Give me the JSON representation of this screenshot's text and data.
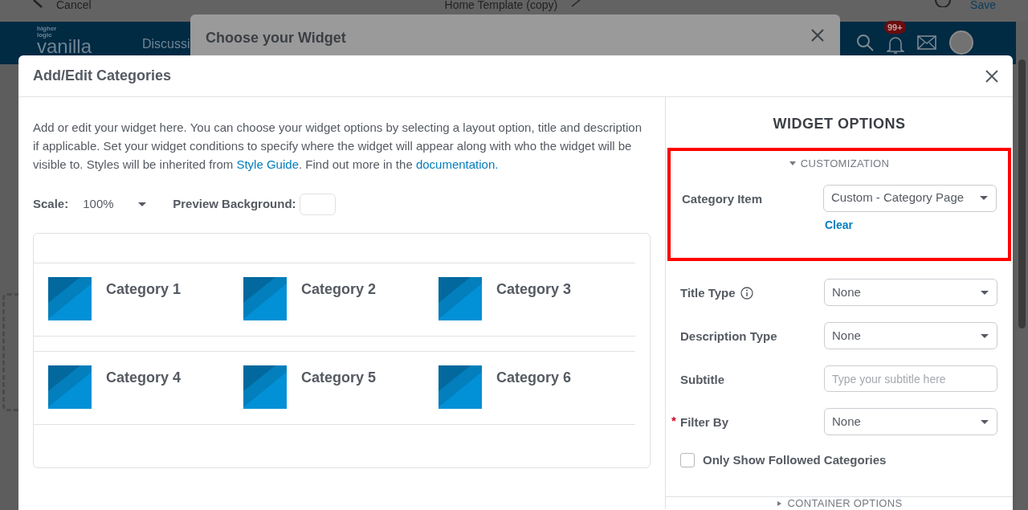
{
  "top_bar": {
    "back_label": "Cancel",
    "title": "Home Template (copy)",
    "save_label": "Save"
  },
  "site_header": {
    "logo_small": "higher logic",
    "logo": "vanilla",
    "nav_item": "Discussi",
    "badge": "99+"
  },
  "back_modal": {
    "title": "Choose your Widget"
  },
  "modal": {
    "title": "Add/Edit Categories",
    "description": [
      {
        "kind": "text",
        "text": "Add or edit your widget here. You can choose your widget options by selecting a layout option, title and description if applicable. Set your widget conditions to specify where the widget will appear along with who the widget will be visible to. Styles will be inherited from "
      },
      {
        "kind": "link",
        "text": "Style Guide"
      },
      {
        "kind": "text",
        "text": ". Find out more in the "
      },
      {
        "kind": "link",
        "text": "documentation."
      }
    ],
    "scale": {
      "label": "Scale:",
      "value": "100%"
    },
    "preview_background": {
      "label": "Preview Background:"
    },
    "category_rows": [
      [
        "Category 1",
        "Category 2",
        "Category 3"
      ],
      [
        "Category 4",
        "Category 5",
        "Category 6"
      ]
    ],
    "options": {
      "title": "WIDGET OPTIONS",
      "customization": {
        "title": "CUSTOMIZATION",
        "expanded": true,
        "highlighted": true,
        "label": "Category Item",
        "value": "Custom - Category Page",
        "clear": "Clear"
      },
      "fields": [
        {
          "kind": "select",
          "label": "Title Type",
          "info": true,
          "value": "None"
        },
        {
          "kind": "select",
          "label": "Description Type",
          "value": "None"
        },
        {
          "kind": "input",
          "label": "Subtitle",
          "placeholder": "Type your subtitle here"
        },
        {
          "kind": "select",
          "label": "Filter By",
          "required_mark": "*",
          "value": "None"
        },
        {
          "kind": "checkbox",
          "label": "Only Show Followed Categories",
          "checked": false
        }
      ],
      "container": {
        "title": "CONTAINER OPTIONS",
        "expanded": false
      }
    }
  }
}
